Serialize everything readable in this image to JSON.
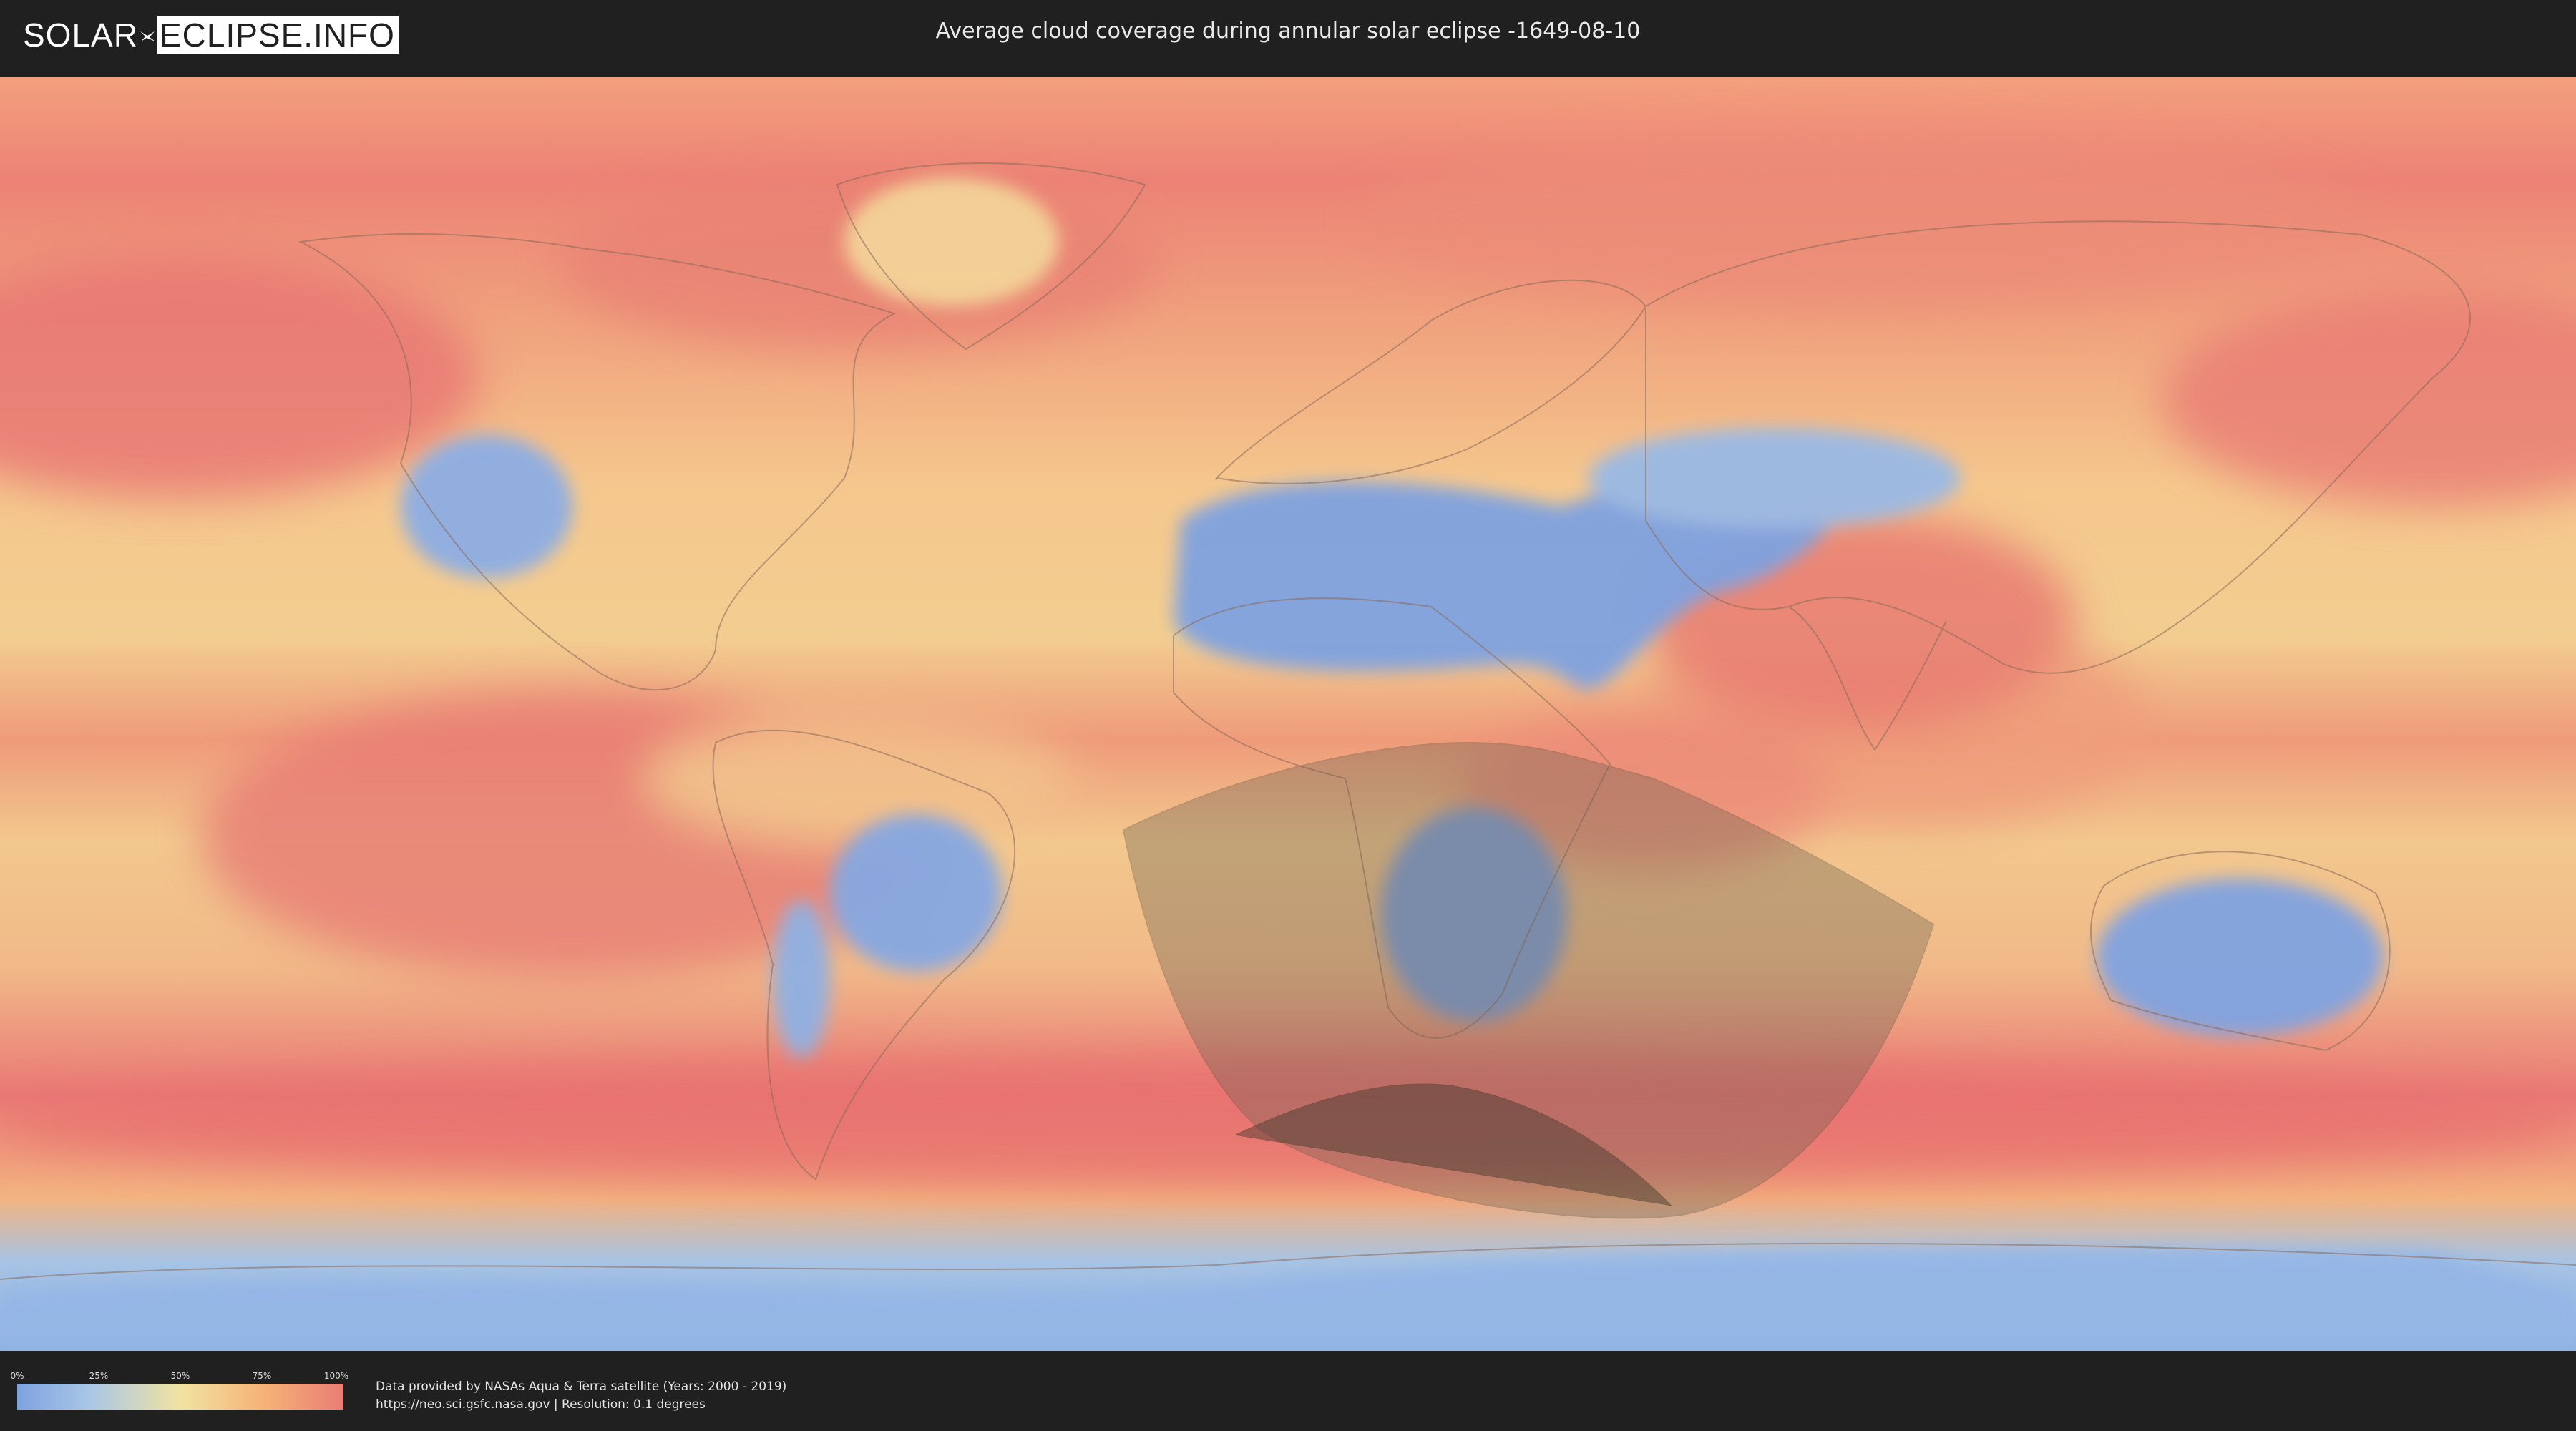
{
  "header": {
    "logo_left": "SOLAR",
    "logo_right": "ECLIPSE.INFO",
    "title": "Average cloud coverage during annular solar eclipse -1649-08-10"
  },
  "legend": {
    "ticks": [
      "0%",
      "25%",
      "50%",
      "75%",
      "100%"
    ],
    "tick_values": [
      0,
      0.25,
      0.5,
      0.75,
      1.0
    ],
    "colors": [
      "#7fa2e0",
      "#a9c6e6",
      "#f1e3a2",
      "#f6b377",
      "#ea7d76"
    ]
  },
  "footer": {
    "credit_line": "Data provided by NASAs Aqua & Terra satellite (Years: 2000 - 2019)",
    "source_line": "https://neo.sci.gsfc.nasa.gov | Resolution: 0.1 degrees"
  },
  "colors": {
    "clear_sky": "#7fa2e0",
    "mid_cloud": "#f1e3a2",
    "overcast": "#ea7d76",
    "eclipse_penumbra": "#6b6150",
    "eclipse_path": "#3f372d"
  },
  "icons": {
    "logo": "eclipse-logo-icon"
  }
}
